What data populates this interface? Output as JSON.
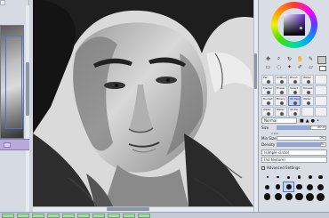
{
  "status_bar": {
    "tabs": [
      "",
      "",
      "",
      "",
      "",
      "",
      "",
      "",
      "",
      ""
    ]
  },
  "tools": {
    "top_icons": [
      "move-icon",
      "zoom-icon",
      "rotate-icon",
      "hand-icon",
      "eyedropper-icon",
      "select-rect-icon",
      "lasso-icon",
      "magic-wand-icon",
      "select-pen-icon",
      "eraser-select-icon"
    ]
  },
  "brushes": {
    "items": [
      {
        "label": "Pen",
        "icon": "pen-icon",
        "selected": false
      },
      {
        "label": "AirBrush",
        "icon": "airbrush-icon",
        "selected": false
      },
      {
        "label": "Brush",
        "icon": "brush-icon",
        "selected": false
      },
      {
        "label": "Water",
        "icon": "water-icon",
        "selected": false
      },
      {
        "label": "",
        "icon": "blank",
        "selected": false
      },
      {
        "label": "Marker",
        "icon": "marker-icon",
        "selected": false
      },
      {
        "label": "Eraser",
        "icon": "eraser-icon",
        "selected": false
      },
      {
        "label": "Select",
        "icon": "select-icon",
        "selected": false
      },
      {
        "label": "Deselect",
        "icon": "deselect-icon",
        "selected": false
      },
      {
        "label": "",
        "icon": "blank",
        "selected": false
      },
      {
        "label": "Bucket",
        "icon": "bucket-icon",
        "selected": false
      },
      {
        "label": "Binary",
        "icon": "binary-icon",
        "selected": false
      },
      {
        "label": "Oil Pain",
        "icon": "oil-paint-icon",
        "selected": true
      },
      {
        "label": "Water",
        "icon": "water-icon",
        "selected": false
      },
      {
        "label": "",
        "icon": "blank",
        "selected": false
      },
      {
        "label": "Water",
        "icon": "water-icon",
        "selected": false
      },
      {
        "label": "Water",
        "icon": "water-icon",
        "selected": false
      },
      {
        "label": "Oil Pai",
        "icon": "oil-paint-icon",
        "selected": false
      },
      {
        "label": "",
        "icon": "blank",
        "selected": false
      },
      {
        "label": "",
        "icon": "blank",
        "selected": false
      }
    ]
  },
  "params": {
    "blend_mode": "Normal",
    "size_label": "Size",
    "size_multiplier": "x 0.1",
    "size_value": "80.0",
    "min_size_label": "Min Size",
    "min_size_value": "0%",
    "density_label": "Density",
    "density_value": "91",
    "shape_select": "(simple circle)",
    "texture_select": "(no texture)",
    "advanced_settings": "Advanced Settings"
  },
  "colors": {
    "main": "#c8c8c8",
    "sub": "#ffffff",
    "accent": "#8fa6e6"
  }
}
